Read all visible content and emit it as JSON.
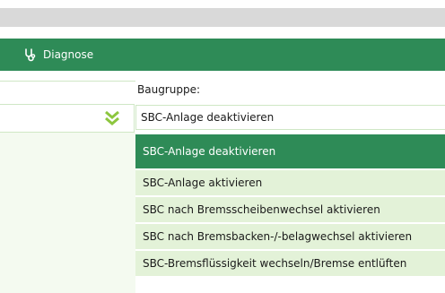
{
  "header": {
    "title": "Diagnose",
    "icon": "stethoscope-icon"
  },
  "form": {
    "label": "Baugruppe:",
    "selected_value": "SBC-Anlage deaktivieren"
  },
  "dropdown": {
    "options": [
      {
        "label": "SBC-Anlage deaktivieren",
        "selected": true
      },
      {
        "label": "SBC-Anlage aktivieren",
        "selected": false
      },
      {
        "label": "SBC nach Bremsscheibenwechsel aktivieren",
        "selected": false
      },
      {
        "label": "SBC nach Bremsbacken-/-belagwechsel aktivieren",
        "selected": false
      },
      {
        "label": "SBC-Bremsflüssigkeit wechseln/Bremse entlüften",
        "selected": false
      }
    ]
  },
  "colors": {
    "accent": "#2e8b57",
    "option_bg": "#e3f2d8",
    "chevron": "#8dc63f"
  }
}
